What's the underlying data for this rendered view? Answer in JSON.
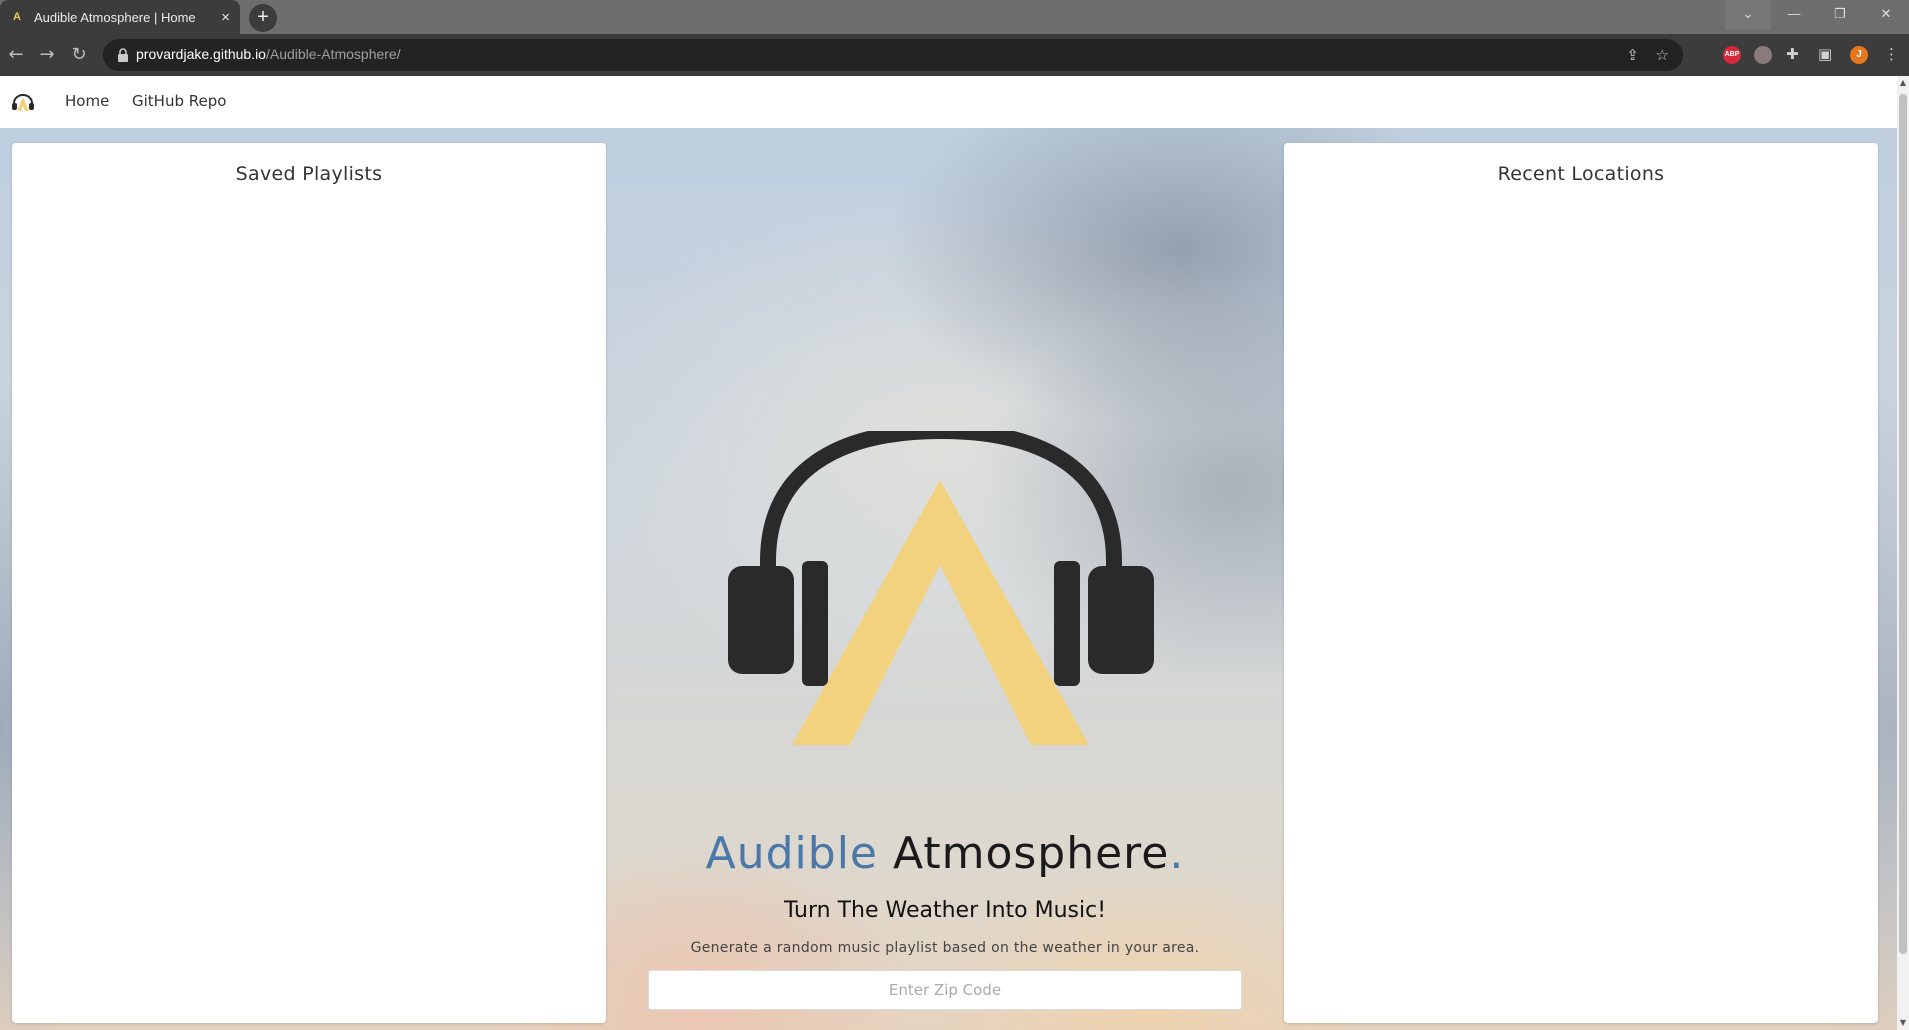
{
  "browser": {
    "tab_title": "Audible Atmosphere | Home",
    "tab_favicon_letter": "A",
    "tab_close": "×",
    "new_tab": "+",
    "url_host": "provardjake.github.io",
    "url_path": "/Audible-Atmosphere/",
    "profile_initial": "J",
    "adblock_label": "ABP",
    "window_controls": {
      "dropdown": "⌄",
      "minimize": "—",
      "restore": "❐",
      "close": "✕"
    }
  },
  "navbar": {
    "links": [
      {
        "label": "Home"
      },
      {
        "label": "GitHub Repo"
      }
    ]
  },
  "panels": {
    "left_title": "Saved Playlists",
    "right_title": "Recent Locations"
  },
  "hero": {
    "title_part1": "Audible",
    "title_part2": "Atmosphere",
    "title_part3": ".",
    "tagline": "Turn The Weather Into Music!",
    "subtext": "Generate a random music playlist based on the weather in your area.",
    "zip_placeholder": "Enter Zip Code",
    "zip_value": ""
  },
  "colors": {
    "accent_blue": "#4a78a8",
    "logo_yellow": "#f2d27e",
    "headphone_dark": "#2a2a2a"
  }
}
